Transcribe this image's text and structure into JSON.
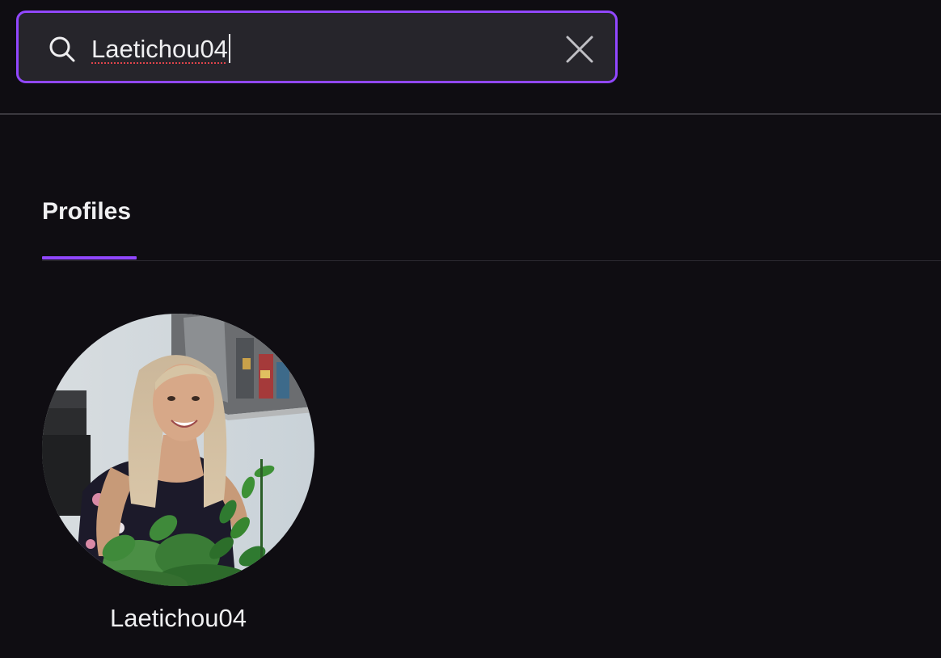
{
  "search": {
    "value": "Laetichou04",
    "accent_color": "#9147ff",
    "icon": "search-icon",
    "clear_icon": "close-icon"
  },
  "tabs": [
    {
      "label": "Profiles",
      "active": true
    }
  ],
  "results": {
    "profiles": [
      {
        "name": "Laetichou04",
        "avatar": "profile-photo"
      }
    ]
  }
}
